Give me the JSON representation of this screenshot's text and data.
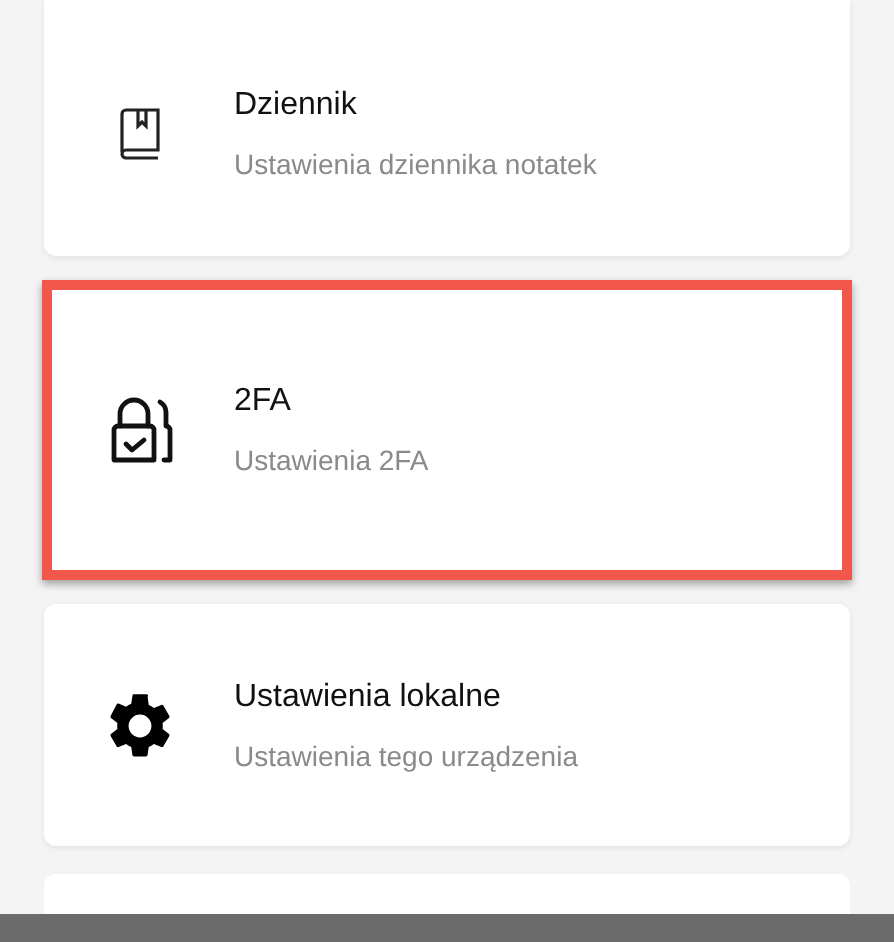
{
  "settings": [
    {
      "title": "Dziennik",
      "subtitle": "Ustawienia dziennika notatek",
      "highlighted": false
    },
    {
      "title": "2FA",
      "subtitle": "Ustawienia 2FA",
      "highlighted": true
    },
    {
      "title": "Ustawienia lokalne",
      "subtitle": "Ustawienia tego urządzenia",
      "highlighted": false
    }
  ]
}
